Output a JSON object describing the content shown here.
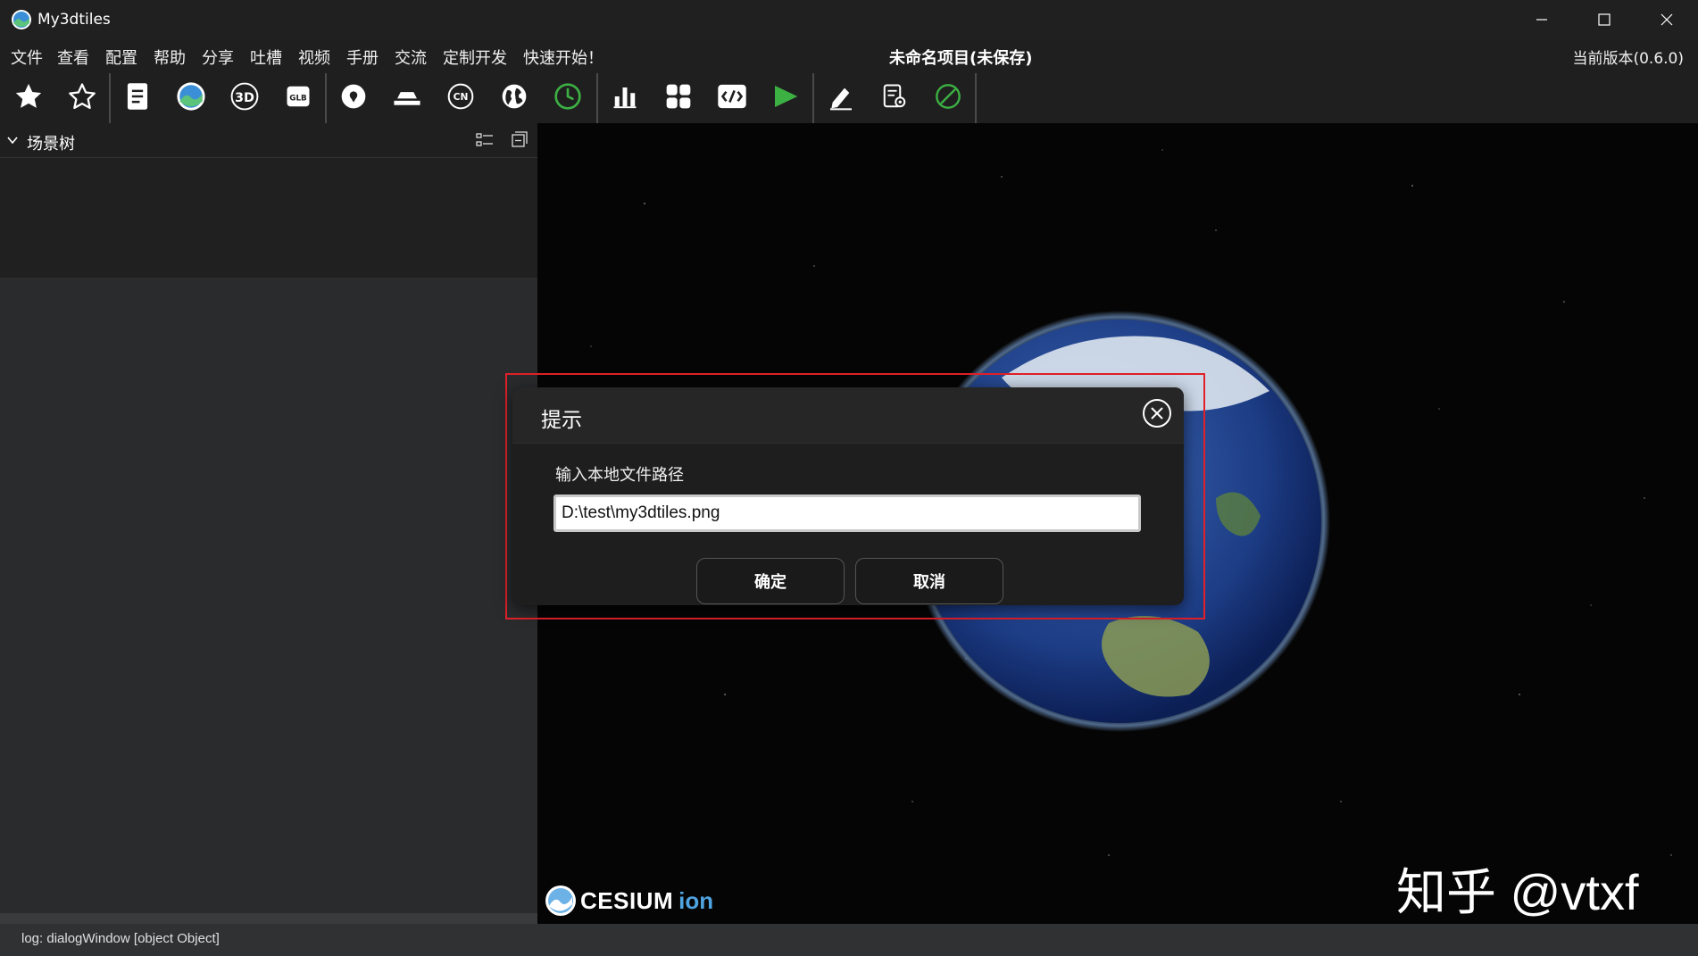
{
  "window": {
    "title": "My3dtiles",
    "minimize_icon": "minimize-icon",
    "maximize_icon": "maximize-icon",
    "close_icon": "close-icon"
  },
  "menu": {
    "items": [
      "文件",
      "查看",
      "配置",
      "帮助",
      "分享",
      "吐槽",
      "视频",
      "手册",
      "交流",
      "定制开发",
      "快速开始！"
    ],
    "project_title": "未命名项目(未保存)",
    "version": "当前版本(0.6.0)"
  },
  "toolbar": {
    "icons": [
      "star-filled-icon",
      "star-outline-icon",
      "document-icon",
      "image-layer-icon",
      "3d-model-icon",
      "glb-icon",
      "location-icon",
      "terrain-icon",
      "cn-icon",
      "globe-icon",
      "clock-icon",
      "bar-chart-icon",
      "widgets-icon",
      "code-icon",
      "play-icon",
      "edit-icon",
      "settings-list-icon",
      "clear-icon"
    ],
    "accent_green": "#3cb043"
  },
  "left_panel": {
    "title": "场景树",
    "collapse_icon": "chevron-down-icon",
    "tree_icon": "tree-view-icon",
    "collapse_all_icon": "collapse-all-icon"
  },
  "viewer": {
    "logo_text": "CESIUM",
    "logo_suffix": "ion",
    "watermark": "知乎 @vtxf"
  },
  "dialog": {
    "title": "提示",
    "label": "输入本地文件路径",
    "input_value": "D:\\test\\my3dtiles.png",
    "confirm": "确定",
    "cancel": "取消",
    "highlight_color": "#e0202a"
  },
  "status": {
    "text": "log: dialogWindow [object Object]"
  }
}
